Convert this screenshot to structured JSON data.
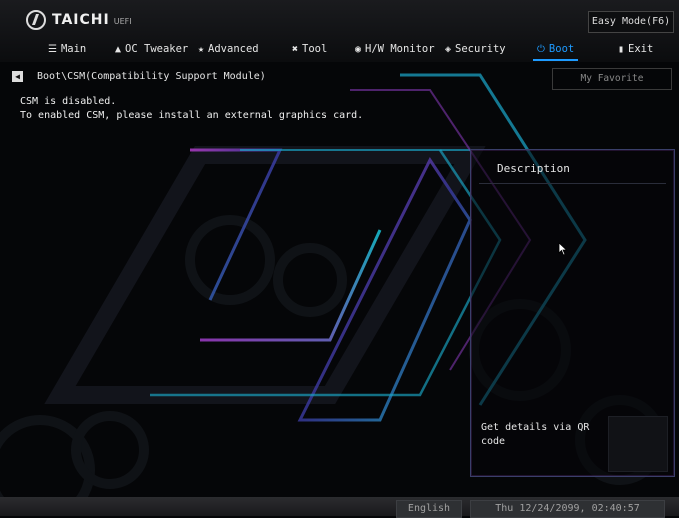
{
  "brand": {
    "name": "TAICHI",
    "sub": "UEFI"
  },
  "easy_mode_label": "Easy Mode(F6)",
  "nav": {
    "items": [
      {
        "label": "Main",
        "icon": "list-icon"
      },
      {
        "label": "OC Tweaker",
        "icon": "rocket-icon"
      },
      {
        "label": "Advanced",
        "icon": "star-icon"
      },
      {
        "label": "Tool",
        "icon": "tools-icon"
      },
      {
        "label": "H/W Monitor",
        "icon": "monitor-icon"
      },
      {
        "label": "Security",
        "icon": "shield-icon"
      },
      {
        "label": "Boot",
        "icon": "power-icon",
        "active": true
      },
      {
        "label": "Exit",
        "icon": "exit-icon"
      }
    ]
  },
  "breadcrumb": "Boot\\CSM(Compatibility Support Module)",
  "favorite_label": "My Favorite",
  "messages": [
    "CSM is disabled.",
    "To enabled CSM, please install an external graphics card."
  ],
  "description": {
    "title": "Description",
    "qr_text": "Get details via QR code"
  },
  "footer": {
    "language": "English",
    "datetime": "Thu 12/24/2099, 02:40:57"
  },
  "colors": {
    "accent": "#1e9bff",
    "panel_border": "#3a3f6a"
  }
}
